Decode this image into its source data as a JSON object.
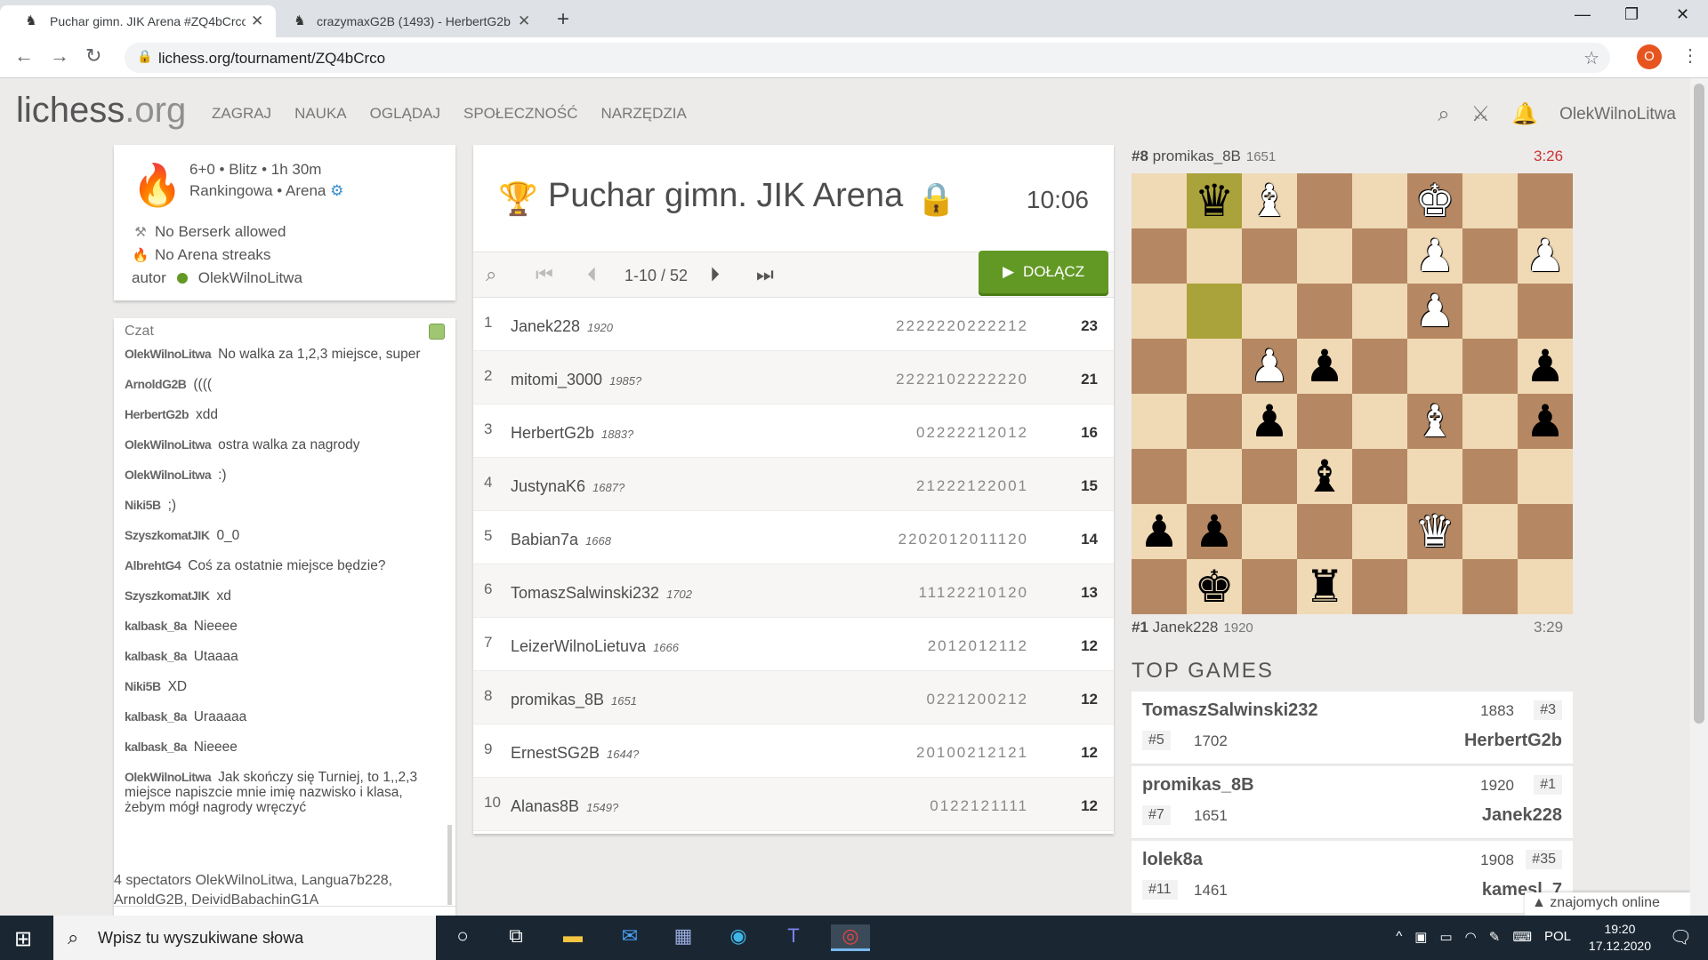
{
  "browser": {
    "tabs": [
      {
        "title": "Puchar gimn. JIK Arena #ZQ4bCrco",
        "active": true
      },
      {
        "title": "crazymaxG2B (1493) - HerbertG2b",
        "active": false
      }
    ],
    "url": "lichess.org/tournament/ZQ4bCrco",
    "profile_initial": "O"
  },
  "site": {
    "logo_main": "lichess",
    "logo_tld": ".org",
    "nav": [
      "ZAGRAJ",
      "NAUKA",
      "OGLĄDAJ",
      "SPOŁECZNOŚĆ",
      "NARZĘDZIA"
    ],
    "username": "OlekWilnoLitwa"
  },
  "info": {
    "line1": "6+0 • Blitz • 1h 30m",
    "line2": "Rankingowa • Arena",
    "no_berserk": "No Berserk allowed",
    "no_streaks": "No Arena streaks",
    "author_label": "autor",
    "author": "OlekWilnoLitwa"
  },
  "chat": {
    "header": "Czat",
    "messages": [
      {
        "user": "OlekWilnoLitwa",
        "text": "No walka za 1,2,3 miejsce, super"
      },
      {
        "user": "ArnoldG2B",
        "text": "(((("
      },
      {
        "user": "HerbertG2b",
        "text": "xdd"
      },
      {
        "user": "OlekWilnoLitwa",
        "text": "ostra walka za nagrody"
      },
      {
        "user": "OlekWilnoLitwa",
        "text": ":)"
      },
      {
        "user": "Niki5B",
        "text": ";)"
      },
      {
        "user": "SzyszkomatJIK",
        "text": "0_0"
      },
      {
        "user": "AlbrehtG4",
        "text": "Coś za ostatnie miejsce będzie?"
      },
      {
        "user": "SzyszkomatJIK",
        "text": "xd"
      },
      {
        "user": "kalbask_8a",
        "text": "Nieeee"
      },
      {
        "user": "kalbask_8a",
        "text": "Utaaaa"
      },
      {
        "user": "Niki5B",
        "text": "XD"
      },
      {
        "user": "kalbask_8a",
        "text": "Uraaaaa"
      },
      {
        "user": "kalbask_8a",
        "text": "Nieeee"
      },
      {
        "user": "OlekWilnoLitwa",
        "text": "Jak skończy się Turniej, to 1,,2,3 miejsce napiszcie mnie imię nazwisko i klasa, żebym mógł nagrody wręczyć"
      }
    ],
    "spectators": "4 spectators OlekWilnoLitwa, Langua7b228, ArnoldG2B, DeividBabachinG1A"
  },
  "tournament": {
    "title": "Puchar gimn. JIK Arena",
    "clock": "10:06",
    "page": "1-10 / 52",
    "join_label": "DOŁĄCZ",
    "standings": [
      {
        "rank": "1",
        "name": "Janek228",
        "rating": "1920",
        "sheet": "2222220222212",
        "score": "23"
      },
      {
        "rank": "2",
        "name": "mitomi_3000",
        "rating": "1985?",
        "sheet": "2222102222220",
        "score": "21"
      },
      {
        "rank": "3",
        "name": "HerbertG2b",
        "rating": "1883?",
        "sheet": "02222212012",
        "score": "16"
      },
      {
        "rank": "4",
        "name": "JustynaK6",
        "rating": "1687?",
        "sheet": "21222122001",
        "score": "15"
      },
      {
        "rank": "5",
        "name": "Babian7a",
        "rating": "1668",
        "sheet": "2202012011120",
        "score": "14"
      },
      {
        "rank": "6",
        "name": "TomaszSalwinski232",
        "rating": "1702",
        "sheet": "11122210120",
        "score": "13"
      },
      {
        "rank": "7",
        "name": "LeizerWilnoLietuva",
        "rating": "1666",
        "sheet": "2012012112",
        "score": "12"
      },
      {
        "rank": "8",
        "name": "promikas_8B",
        "rating": "1651",
        "sheet": "0221200212",
        "score": "12"
      },
      {
        "rank": "9",
        "name": "ErnestSG2B",
        "rating": "1644?",
        "sheet": "20100212121",
        "score": "12"
      },
      {
        "rank": "10",
        "name": "Alanas8B",
        "rating": "1549?",
        "sheet": "0122121111",
        "score": "12"
      }
    ]
  },
  "featured": {
    "top": {
      "rank": "#8",
      "name": "promikas_8B",
      "rating": "1651",
      "clock": "3:26"
    },
    "bottom": {
      "rank": "#1",
      "name": "Janek228",
      "rating": "1920",
      "clock": "3:29"
    },
    "board": [
      [
        "",
        "bq",
        "wb",
        "",
        "",
        "wk",
        "",
        ""
      ],
      [
        "",
        "",
        "",
        "",
        "",
        "wp",
        "",
        "wp"
      ],
      [
        "",
        "",
        "",
        "",
        "",
        "wp",
        "",
        ""
      ],
      [
        "",
        "",
        "wp",
        "bp",
        "",
        "",
        "",
        "bp"
      ],
      [
        "",
        "",
        "bp",
        "",
        "",
        "wb",
        "",
        "bp"
      ],
      [
        "",
        "",
        "",
        "bb",
        "",
        "",
        "",
        ""
      ],
      [
        "bp",
        "bp",
        "",
        "",
        "",
        "wq",
        "",
        ""
      ],
      [
        "",
        "bk",
        "",
        "br",
        "",
        "",
        "",
        ""
      ]
    ]
  },
  "top_games": {
    "heading": "TOP GAMES",
    "games": [
      {
        "p1": "TomaszSalwinski232",
        "r1": "1883",
        "rk1": "#3",
        "rk2": "#5",
        "r2": "1702",
        "p2": "HerbertG2b"
      },
      {
        "p1": "promikas_8B",
        "r1": "1920",
        "rk1": "#1",
        "rk2": "#7",
        "r2": "1651",
        "p2": "Janek228"
      },
      {
        "p1": "lolek8a",
        "r1": "1908",
        "rk1": "#35",
        "rk2": "#11",
        "r2": "1461",
        "p2": "kamesl_7"
      }
    ]
  },
  "online": "znajomych online",
  "taskbar": {
    "search": "Wpisz tu wyszukiwane słowa",
    "lang": "POL",
    "time": "19:20",
    "date": "17.12.2020"
  }
}
